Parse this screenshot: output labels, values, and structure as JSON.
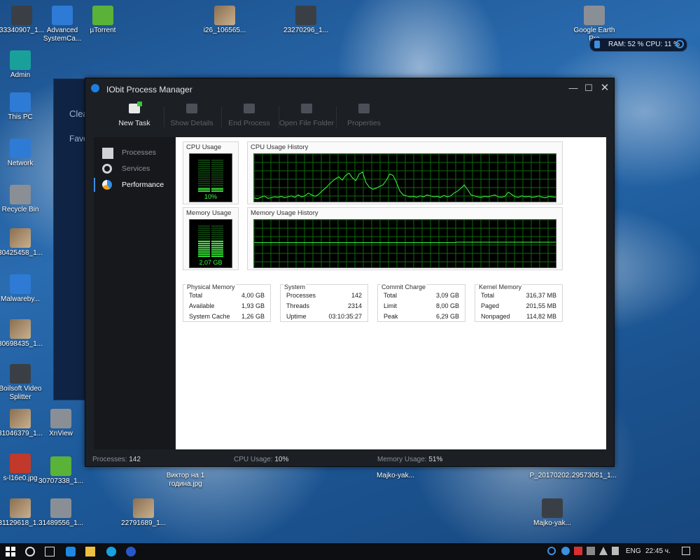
{
  "desktop": {
    "icons": [
      {
        "label": "33340907_1..."
      },
      {
        "label": "Advanced SystemCa..."
      },
      {
        "label": "µTorrent"
      },
      {
        "label": "i26_106565..."
      },
      {
        "label": "23270296_1..."
      },
      {
        "label": "Google Earth Pro"
      },
      {
        "label": "Admin"
      },
      {
        "label": "This PC"
      },
      {
        "label": "Network"
      },
      {
        "label": "Recycle Bin"
      },
      {
        "label": "30425458_1..."
      },
      {
        "label": "Malwareby..."
      },
      {
        "label": "30698435_1..."
      },
      {
        "label": "Boilsoft Video Splitter"
      },
      {
        "label": "31046379_1..."
      },
      {
        "label": "XnView"
      },
      {
        "label": "s-l16e0.jpg"
      },
      {
        "label": "30707338_1..."
      },
      {
        "label": "Виктор на 1 година.jpg"
      },
      {
        "label": "Majko-yak..."
      },
      {
        "label": "P_20170202..."
      },
      {
        "label": "29573051_1..."
      },
      {
        "label": "31129618_1..."
      },
      {
        "label": "31489556_1..."
      },
      {
        "label": "22791689_1..."
      },
      {
        "label": "Majko-yak..."
      }
    ]
  },
  "background_app": {
    "label1": "Clea",
    "label2": "Favori"
  },
  "widget": {
    "text": "RAM: 52 %  CPU: 11 %"
  },
  "window": {
    "title": "IObit Process Manager",
    "toolbar": [
      {
        "label": "New Task",
        "enabled": true
      },
      {
        "label": "Show Details",
        "enabled": false
      },
      {
        "label": "End Process",
        "enabled": false
      },
      {
        "label": "Open File Folder",
        "enabled": false
      },
      {
        "label": "Properties",
        "enabled": false
      }
    ],
    "sidebar": [
      {
        "label": "Processes",
        "active": false
      },
      {
        "label": "Services",
        "active": false
      },
      {
        "label": "Performance",
        "active": true
      }
    ],
    "performance": {
      "cpu_usage": {
        "title": "CPU Usage",
        "value": "10%",
        "fraction": 0.1
      },
      "cpu_history": {
        "title": "CPU Usage History",
        "values": [
          8,
          6,
          9,
          12,
          7,
          8,
          10,
          9,
          11,
          8,
          10,
          12,
          9,
          14,
          10,
          12,
          18,
          14,
          11,
          15,
          22,
          28,
          35,
          42,
          48,
          52,
          45,
          55,
          60,
          50,
          44,
          58,
          62,
          40,
          30,
          26,
          28,
          32,
          35,
          45,
          58,
          55,
          40,
          22,
          14,
          12,
          10,
          11,
          9,
          12,
          10,
          14,
          12,
          10,
          11,
          9,
          13,
          10,
          12,
          18,
          22,
          28,
          35,
          25,
          14,
          12,
          10,
          9,
          11,
          10,
          12,
          14,
          10,
          9,
          11,
          20,
          15,
          10,
          9,
          12,
          10,
          11,
          9,
          10,
          12,
          9,
          8,
          11,
          10,
          9
        ]
      },
      "memory_usage": {
        "title": "Memory Usage",
        "value": "2,07 GB",
        "fraction": 0.52
      },
      "memory_history": {
        "title": "Memory Usage History",
        "values": [
          52,
          52,
          52,
          52,
          52,
          52,
          52,
          52,
          52,
          52,
          52,
          52,
          52,
          52,
          52,
          52,
          52,
          52,
          52,
          52,
          52,
          52,
          52,
          52,
          52,
          52,
          52,
          52,
          52,
          52,
          52,
          52,
          52,
          52,
          52,
          52,
          52,
          52,
          52,
          52,
          52,
          52,
          52,
          52,
          52,
          52,
          52,
          52,
          52,
          52,
          52,
          52,
          52,
          52,
          52,
          52,
          52,
          52,
          52,
          52,
          53,
          53,
          53,
          53,
          53,
          53,
          53,
          53,
          53,
          53,
          53,
          53,
          53,
          53,
          53,
          53,
          53,
          53,
          53,
          53,
          53,
          53,
          53,
          53,
          53,
          53,
          53,
          53,
          53,
          53
        ]
      },
      "physical_memory": {
        "title": "Physical Memory",
        "rows": [
          {
            "k": "Total",
            "v": "4,00 GB"
          },
          {
            "k": "Available",
            "v": "1,93 GB"
          },
          {
            "k": "System Cache",
            "v": "1,26 GB"
          }
        ]
      },
      "system": {
        "title": "System",
        "rows": [
          {
            "k": "Processes",
            "v": "142"
          },
          {
            "k": "Threads",
            "v": "2314"
          },
          {
            "k": "Uptime",
            "v": "03:10:35:27"
          }
        ]
      },
      "commit_charge": {
        "title": "Commit Charge",
        "rows": [
          {
            "k": "Total",
            "v": "3,09 GB"
          },
          {
            "k": "Limit",
            "v": "8,00 GB"
          },
          {
            "k": "Peak",
            "v": "6,29 GB"
          }
        ]
      },
      "kernel_memory": {
        "title": "Kernel Memory",
        "rows": [
          {
            "k": "Total",
            "v": "316,37 MB"
          },
          {
            "k": "Paged",
            "v": "201,55 MB"
          },
          {
            "k": "Nonpaged",
            "v": "114,82 MB"
          }
        ]
      }
    },
    "status": {
      "processes_label": "Processes:",
      "processes_value": "142",
      "cpu_label": "CPU Usage:",
      "cpu_value": "10%",
      "mem_label": "Memory Usage:",
      "mem_value": "51%"
    }
  },
  "taskbar": {
    "lang": "ENG",
    "clock": "22:45 ч."
  },
  "colors": {
    "graph_line": "#3dff3d",
    "grid": "#0d6b0d",
    "accent": "#3c8ce0"
  }
}
